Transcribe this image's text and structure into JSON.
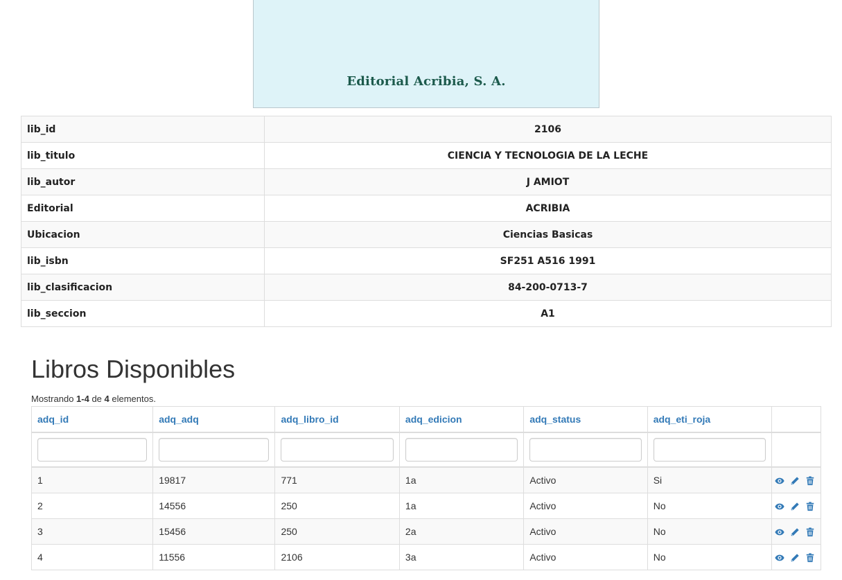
{
  "cover": {
    "publisher": "Editorial Acribia, S. A."
  },
  "detail": {
    "rows": [
      {
        "label": "lib_id",
        "value": "2106"
      },
      {
        "label": "lib_titulo",
        "value": "CIENCIA Y TECNOLOGIA DE LA LECHE"
      },
      {
        "label": "lib_autor",
        "value": "J AMIOT"
      },
      {
        "label": "Editorial",
        "value": "ACRIBIA"
      },
      {
        "label": "Ubicacion",
        "value": "Ciencias Basicas"
      },
      {
        "label": "lib_isbn",
        "value": "SF251 A516 1991"
      },
      {
        "label": "lib_clasificacion",
        "value": "84-200-0713-7"
      },
      {
        "label": "lib_seccion",
        "value": "A1"
      }
    ]
  },
  "section": {
    "title": "Libros Disponibles",
    "summary_prefix": "Mostrando ",
    "summary_range": "1-4",
    "summary_mid": " de ",
    "summary_total": "4",
    "summary_suffix": " elementos."
  },
  "grid": {
    "columns": [
      "adq_id",
      "adq_adq",
      "adq_libro_id",
      "adq_edicion",
      "adq_status",
      "adq_eti_roja"
    ],
    "filters": [
      "",
      "",
      "",
      "",
      "",
      ""
    ],
    "rows": [
      [
        "1",
        "19817",
        "771",
        "1a",
        "Activo",
        "Si"
      ],
      [
        "2",
        "14556",
        "250",
        "1a",
        "Activo",
        "No"
      ],
      [
        "3",
        "15456",
        "250",
        "2a",
        "Activo",
        "No"
      ],
      [
        "4",
        "11556",
        "2106",
        "3a",
        "Activo",
        "No"
      ]
    ],
    "action_icons": [
      "eye-icon",
      "pencil-icon",
      "trash-icon"
    ],
    "action_color": "#337ab7"
  }
}
